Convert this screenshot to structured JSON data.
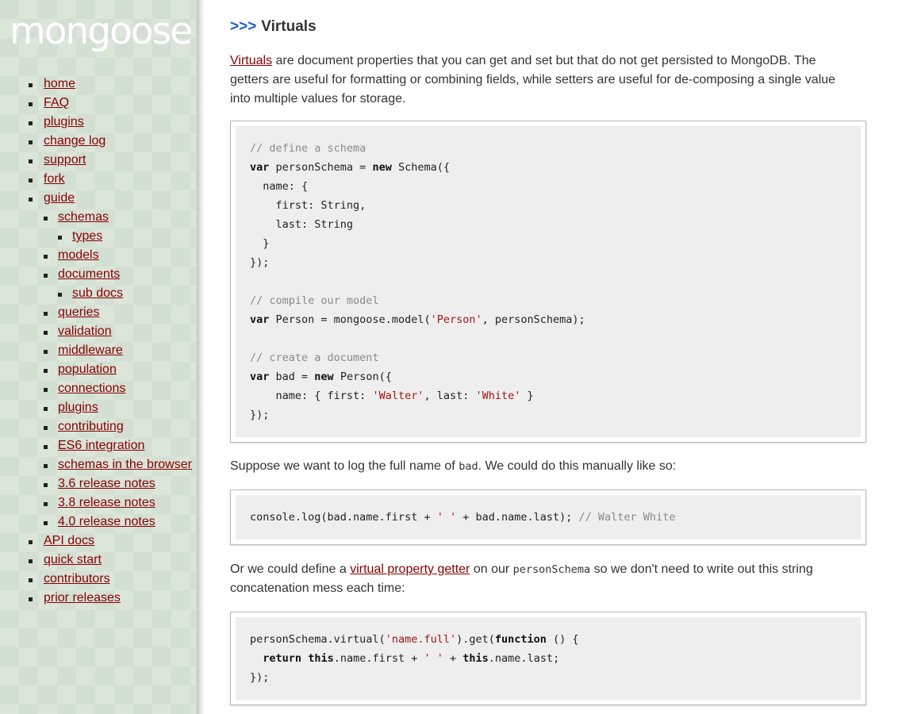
{
  "sidebar": {
    "logo": "mongoose",
    "items": [
      {
        "label": "home",
        "level": 0
      },
      {
        "label": "FAQ",
        "level": 0
      },
      {
        "label": "plugins",
        "level": 0
      },
      {
        "label": "change log",
        "level": 0
      },
      {
        "label": "support",
        "level": 0
      },
      {
        "label": "fork",
        "level": 0
      },
      {
        "label": "guide",
        "level": 0
      },
      {
        "label": "schemas",
        "level": 1
      },
      {
        "label": "types",
        "level": 2
      },
      {
        "label": "models",
        "level": 1
      },
      {
        "label": "documents",
        "level": 1
      },
      {
        "label": "sub docs",
        "level": 2
      },
      {
        "label": "queries",
        "level": 1
      },
      {
        "label": "validation",
        "level": 1
      },
      {
        "label": "middleware",
        "level": 1
      },
      {
        "label": "population",
        "level": 1
      },
      {
        "label": "connections",
        "level": 1
      },
      {
        "label": "plugins",
        "level": 1
      },
      {
        "label": "contributing",
        "level": 1
      },
      {
        "label": "ES6 integration",
        "level": 1
      },
      {
        "label": "schemas in the browser",
        "level": 1
      },
      {
        "label": "3.6 release notes",
        "level": 1
      },
      {
        "label": "3.8 release notes",
        "level": 1
      },
      {
        "label": "4.0 release notes",
        "level": 1
      },
      {
        "label": "API docs",
        "level": 0
      },
      {
        "label": "quick start",
        "level": 0
      },
      {
        "label": "contributors",
        "level": 0
      },
      {
        "label": "prior releases",
        "level": 0
      }
    ]
  },
  "main": {
    "heading_arrows": ">>>",
    "heading": "Virtuals",
    "intro": {
      "link": "Virtuals",
      "text": " are document properties that you can get and set but that do not get persisted to MongoDB. The getters are useful for formatting or combining fields, while setters are useful for de-composing a single value into multiple values for storage."
    },
    "para2": {
      "before": "Suppose we want to log the full name of ",
      "code": "bad",
      "after": ". We could do this manually like so:"
    },
    "para3": {
      "before": "Or we could define a ",
      "link": "virtual property getter",
      "middle": " on our ",
      "code": "personSchema",
      "after": " so we don't need to write out this string concatenation mess each time:"
    },
    "code_blocks": [
      [
        [
          {
            "t": "// define a schema",
            "c": "c"
          }
        ],
        [
          {
            "t": "var",
            "c": "k"
          },
          {
            "t": " personSchema = "
          },
          {
            "t": "new",
            "c": "k"
          },
          {
            "t": " Schema({"
          }
        ],
        [
          {
            "t": "  name: {"
          }
        ],
        [
          {
            "t": "    first: String,"
          }
        ],
        [
          {
            "t": "    last: String"
          }
        ],
        [
          {
            "t": "  }"
          }
        ],
        [
          {
            "t": "});"
          }
        ],
        [],
        [
          {
            "t": "// compile our model",
            "c": "c"
          }
        ],
        [
          {
            "t": "var",
            "c": "k"
          },
          {
            "t": " Person = mongoose.model("
          },
          {
            "t": "'Person'",
            "c": "s"
          },
          {
            "t": ", personSchema);"
          }
        ],
        [],
        [
          {
            "t": "// create a document",
            "c": "c"
          }
        ],
        [
          {
            "t": "var",
            "c": "k"
          },
          {
            "t": " bad = "
          },
          {
            "t": "new",
            "c": "k"
          },
          {
            "t": " Person({"
          }
        ],
        [
          {
            "t": "    name: { first: "
          },
          {
            "t": "'Walter'",
            "c": "s"
          },
          {
            "t": ", last: "
          },
          {
            "t": "'White'",
            "c": "s"
          },
          {
            "t": " }"
          }
        ],
        [
          {
            "t": "});"
          }
        ]
      ],
      [
        [
          {
            "t": "console.log(bad.name.first + "
          },
          {
            "t": "' '",
            "c": "s"
          },
          {
            "t": " + bad.name.last); "
          },
          {
            "t": "// Walter White",
            "c": "c"
          }
        ]
      ],
      [
        [
          {
            "t": "personSchema.virtual("
          },
          {
            "t": "'name.full'",
            "c": "s"
          },
          {
            "t": ").get("
          },
          {
            "t": "function",
            "c": "k"
          },
          {
            "t": " () {"
          }
        ],
        [
          {
            "t": "  "
          },
          {
            "t": "return",
            "c": "k"
          },
          {
            "t": " "
          },
          {
            "t": "this",
            "c": "k"
          },
          {
            "t": ".name.first + "
          },
          {
            "t": "' '",
            "c": "s"
          },
          {
            "t": " + "
          },
          {
            "t": "this",
            "c": "k"
          },
          {
            "t": ".name.last;"
          }
        ],
        [
          {
            "t": "});"
          }
        ]
      ]
    ]
  }
}
